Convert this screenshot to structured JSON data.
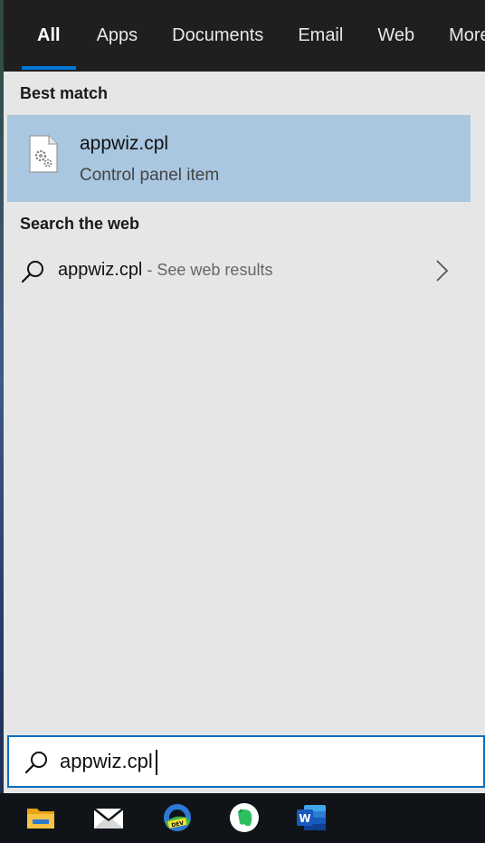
{
  "tabs": [
    {
      "label": "All",
      "active": true
    },
    {
      "label": "Apps",
      "active": false
    },
    {
      "label": "Documents",
      "active": false
    },
    {
      "label": "Email",
      "active": false
    },
    {
      "label": "Web",
      "active": false
    },
    {
      "label": "More",
      "active": false
    }
  ],
  "best_match": {
    "heading": "Best match",
    "title": "appwiz.cpl",
    "subtitle": "Control panel item",
    "icon": "settings-file-icon"
  },
  "web": {
    "heading": "Search the web",
    "query": "appwiz.cpl",
    "suffix": " - See web results",
    "icon": "search-icon"
  },
  "search": {
    "value": "appwiz.cpl"
  },
  "taskbar": [
    {
      "name": "file-explorer-icon"
    },
    {
      "name": "mail-icon"
    },
    {
      "name": "edge-dev-icon"
    },
    {
      "name": "evernote-icon"
    },
    {
      "name": "word-icon"
    }
  ],
  "colors": {
    "accent": "#0078d7",
    "selection": "#a9c7e0",
    "panel": "#e6e6e6",
    "tabbar": "#1f1f1f"
  }
}
